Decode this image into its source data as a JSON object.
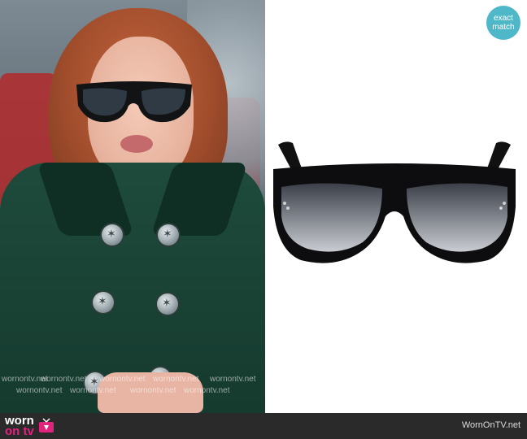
{
  "badge": {
    "line1": "exact",
    "line2": "match"
  },
  "watermark": "wornontv.net",
  "footer": {
    "logo_worn": "worn",
    "logo_on_tv": "on tv",
    "site": "WornOnTV.net"
  },
  "colors": {
    "footer_bg": "#2a2a2a",
    "badge_bg": "#4fb8c8",
    "logo_accent": "#e0247e"
  }
}
